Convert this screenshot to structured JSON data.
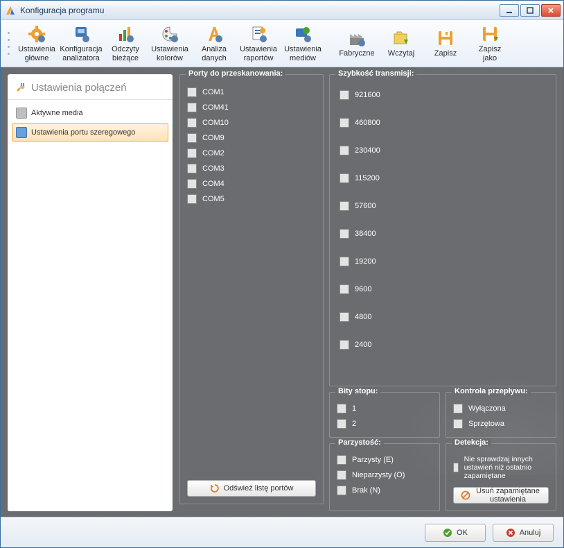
{
  "window": {
    "title": "Konfiguracja programu"
  },
  "toolbar": {
    "items": [
      {
        "label": "Ustawienia\ngłówne",
        "icon": "gear-orange"
      },
      {
        "label": "Konfiguracja\nanalizatora",
        "icon": "device-blue"
      },
      {
        "label": "Odczyty\nbieżące",
        "icon": "bars"
      },
      {
        "label": "Ustawienia\nkolorów",
        "icon": "palette"
      },
      {
        "label": "Analiza\ndanych",
        "icon": "letter-a"
      },
      {
        "label": "Ustawienia\nraportów",
        "icon": "report"
      },
      {
        "label": "Ustawienia\nmediów",
        "icon": "media"
      }
    ],
    "items_right": [
      {
        "label": "Fabryczne",
        "icon": "factory"
      },
      {
        "label": "Wczytaj",
        "icon": "open"
      },
      {
        "label": "Zapisz",
        "icon": "save"
      },
      {
        "label": "Zapisz\njako",
        "icon": "saveas"
      }
    ]
  },
  "sidebar": {
    "title": "Ustawienia połączeń",
    "items": [
      {
        "label": "Aktywne media",
        "selected": false
      },
      {
        "label": "Ustawienia portu szeregowego",
        "selected": true
      }
    ]
  },
  "ports": {
    "title": "Porty do przeskanowania:",
    "items": [
      "COM1",
      "COM41",
      "COM10",
      "COM9",
      "COM2",
      "COM3",
      "COM4",
      "COM5"
    ],
    "refresh": "Odśwież listę portów"
  },
  "speed": {
    "title": "Szybkość transmisji:",
    "items": [
      "921600",
      "460800",
      "230400",
      "115200",
      "57600",
      "38400",
      "19200",
      "9600",
      "4800",
      "2400"
    ]
  },
  "stopbits": {
    "title": "Bity stopu:",
    "items": [
      "1",
      "2"
    ]
  },
  "flow": {
    "title": "Kontrola przepływu:",
    "items": [
      "Wyłączona",
      "Sprzętowa"
    ]
  },
  "parity": {
    "title": "Parzystość:",
    "items": [
      "Parzysty (E)",
      "Nieparzysty (O)",
      "Brak (N)"
    ]
  },
  "detect": {
    "title": "Detekcja:",
    "check": "Nie sprawdzaj innych ustawień niż ostatnio zapamiętane",
    "button": "Usuń zapamiętane ustawienia"
  },
  "footer": {
    "ok": "OK",
    "cancel": "Anuluj"
  }
}
